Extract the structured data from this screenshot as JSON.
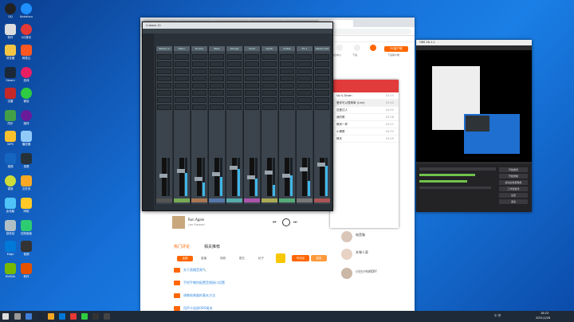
{
  "browser": {
    "tabs": [
      "Cubase 10 …",
      "小鸟播放器…",
      "主页 - 鳌…",
      "知乎 - 有…",
      "播放器 …",
      "博客 | 知…"
    ],
    "url": "",
    "bookmarks": "应用  |  百度  |  淘宝  |  天猫  |  京东  |  知乎  |  微博",
    "site_badge": "PC客户端",
    "nav_items": [
      "消息中心",
      "下载",
      "客服"
    ],
    "download_label": "下载客户端"
  },
  "daw": {
    "title": "Cubase 10",
    "channels": [
      "Stereo In",
      "Piano",
      "Drums",
      "Bass",
      "Strings",
      "Vocal",
      "Synth",
      "Guitar",
      "FX 1",
      "Stereo Out"
    ]
  },
  "music": {
    "playlist": [
      {
        "title": "Up & Down",
        "time": "03:15"
      },
      {
        "title": "爱你可以很简单 (Live)",
        "time": "03:42"
      },
      {
        "title": "恋爱达人",
        "time": "04:02"
      },
      {
        "title": "我的歌",
        "time": "03:28"
      },
      {
        "title": "像风一样",
        "time": "04:11"
      },
      {
        "title": "小情歌",
        "time": "04:33"
      },
      {
        "title": "晴天",
        "time": "04:29"
      }
    ],
    "player_song": "Run Again",
    "player_artist": "Lee Stewart"
  },
  "page": {
    "comment_tab": "热门评论",
    "related_tab": "相关推荐",
    "filter_tabs": [
      "全部",
      "直播",
      "视频",
      "图文",
      "帖子"
    ],
    "primary_btn": "写评论",
    "secondary_btn": "发布",
    "recommended_links": [
      "关于直播音频🔧",
      "手把手教你配置音频接口设置",
      "调教效果器的基本方法",
      "用声卡连接OBS推流"
    ],
    "users": [
      "电音咖",
      "木琴人家",
      "小白小鸟的DIY"
    ],
    "side_label": "下载应用"
  },
  "obs": {
    "title": "OBS 26.1.1",
    "controls": [
      "开始推流",
      "开始录制",
      "启动虚拟摄像机",
      "工作室模式",
      "设置",
      "退出"
    ]
  },
  "desktop_icons": [
    "QQ",
    "Kuaishou",
    "软件",
    "QQ音乐",
    "浏览器",
    "网易云",
    "Steam",
    "游戏",
    "迅雷",
    "微信",
    "同步",
    "媒体",
    "WPS",
    "播放器",
    "视频",
    "录屏",
    "调音",
    "文件夹",
    "此电脑",
    "网络",
    "回收站",
    "控制面板",
    "Edge",
    "音频",
    "NVIDIA",
    "软件"
  ],
  "taskbar": {
    "clock_time": "16:23",
    "clock_date": "2021/1/26",
    "tray_text": "中  拼"
  }
}
